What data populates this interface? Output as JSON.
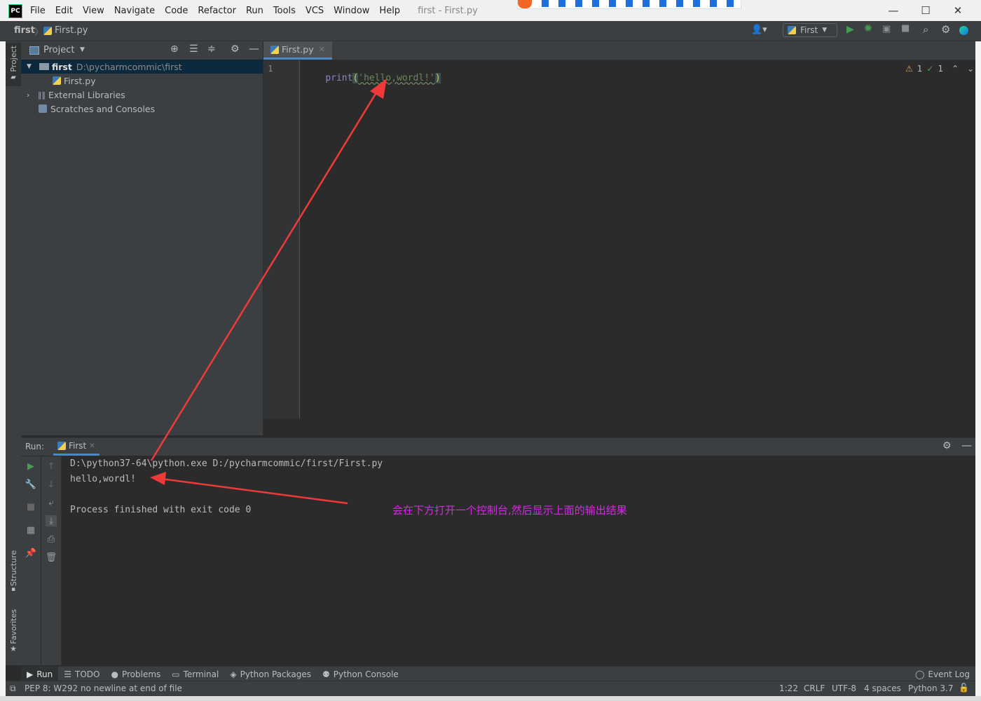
{
  "titlebar": {
    "app_icon": "PC",
    "menu": [
      "File",
      "Edit",
      "View",
      "Navigate",
      "Code",
      "Refactor",
      "Run",
      "Tools",
      "VCS",
      "Window",
      "Help"
    ],
    "title": "first - First.py",
    "minimize": "—",
    "maximize": "☐",
    "close": "✕"
  },
  "navbar": {
    "project": "first",
    "file": "First.py",
    "run_config": "First"
  },
  "left_strip": {
    "project_label": "Project",
    "structure_label": "Structure",
    "favorites_label": "Favorites"
  },
  "project_panel": {
    "title": "Project",
    "root_name": "first",
    "root_path": "D:\\pycharmcommic\\first",
    "file": "First.py",
    "external": "External Libraries",
    "scratches": "Scratches and Consoles"
  },
  "editor": {
    "tab": "First.py",
    "line_number": "1",
    "code_func": "print",
    "code_open": "(",
    "code_string": "'hello,wordl!'",
    "code_close": ")",
    "warnings": "1",
    "weak_warnings": "1"
  },
  "run_panel": {
    "label": "Run:",
    "tab": "First",
    "lines": [
      "D:\\python37-64\\python.exe D:/pycharmcommic/first/First.py",
      "hello,wordl!",
      "",
      "Process finished with exit code 0"
    ],
    "annotation": "会在下方打开一个控制台,然后显示上面的输出结果",
    "annotation_color": "#d42be0"
  },
  "bottom_tabs": [
    "Run",
    "TODO",
    "Problems",
    "Terminal",
    "Python Packages",
    "Python Console"
  ],
  "event_log": "Event Log",
  "status": {
    "message": "PEP 8: W292 no newline at end of file",
    "position": "1:22",
    "line_sep": "CRLF",
    "encoding": "UTF-8",
    "indent": "4 spaces",
    "interpreter": "Python 3.7"
  },
  "colors": {
    "arrow": "#f03a3a",
    "keyword_func": "#8888c6",
    "string": "#6a8759",
    "accent": "#4a88c7"
  }
}
